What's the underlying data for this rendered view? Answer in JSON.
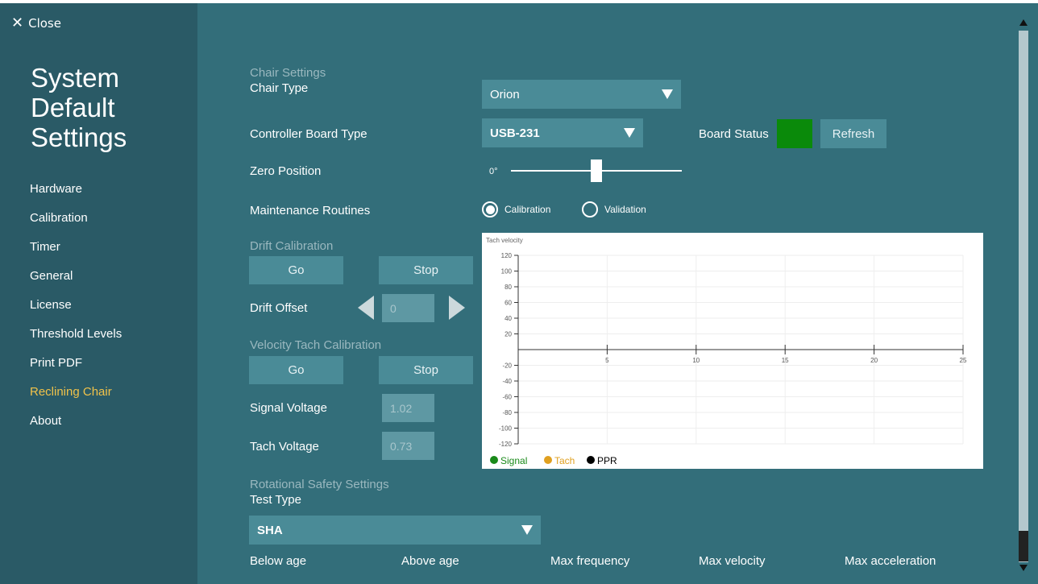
{
  "close_label": "Close",
  "sidebar": {
    "title": "System Default Settings",
    "items": [
      {
        "label": "Hardware"
      },
      {
        "label": "Calibration"
      },
      {
        "label": "Timer"
      },
      {
        "label": "General"
      },
      {
        "label": "License"
      },
      {
        "label": "Threshold Levels"
      },
      {
        "label": "Print PDF"
      },
      {
        "label": "Reclining Chair",
        "active": true
      },
      {
        "label": "About"
      }
    ]
  },
  "chair": {
    "section": "Chair Settings",
    "type_label": "Chair Type",
    "type_value": "Orion",
    "controller_label": "Controller Board Type",
    "controller_value": "USB-231",
    "board_status_label": "Board Status",
    "board_status_color": "#0a8a0a",
    "refresh_label": "Refresh",
    "zero_label": "Zero Position",
    "zero_value": "0°",
    "zero_level": 0.5,
    "maintenance_label": "Maintenance Routines",
    "radio_calibration": "Calibration",
    "radio_validation": "Validation",
    "radio_selected": "Calibration"
  },
  "drift": {
    "section": "Drift Calibration",
    "go": "Go",
    "stop": "Stop",
    "offset_label": "Drift Offset",
    "offset_value": "0"
  },
  "velocity": {
    "section": "Velocity Tach Calibration",
    "go": "Go",
    "stop": "Stop",
    "signal_label": "Signal Voltage",
    "signal_value": "1.02",
    "tach_label": "Tach Voltage",
    "tach_value": "0.73"
  },
  "rotational": {
    "section": "Rotational Safety Settings",
    "test_type_label": "Test Type",
    "test_type_value": "SHA",
    "columns": [
      "Below age",
      "Above age",
      "Max frequency",
      "Max velocity",
      "Max acceleration"
    ]
  },
  "chart_data": {
    "type": "line",
    "title": "Tach velocity",
    "xlim": [
      0,
      25
    ],
    "ylim": [
      -120,
      120
    ],
    "x_ticks": [
      5,
      10,
      15,
      20,
      25
    ],
    "y_ticks": [
      120,
      100,
      80,
      60,
      40,
      20,
      -20,
      -40,
      -60,
      -80,
      -100,
      -120
    ],
    "grid": true,
    "legend_position": "bottom-left",
    "series": [
      {
        "name": "Signal",
        "color": "#1a8a1a",
        "values": []
      },
      {
        "name": "Tach",
        "color": "#e0a020",
        "values": []
      },
      {
        "name": "PPR",
        "color": "#000000",
        "values": []
      }
    ]
  }
}
